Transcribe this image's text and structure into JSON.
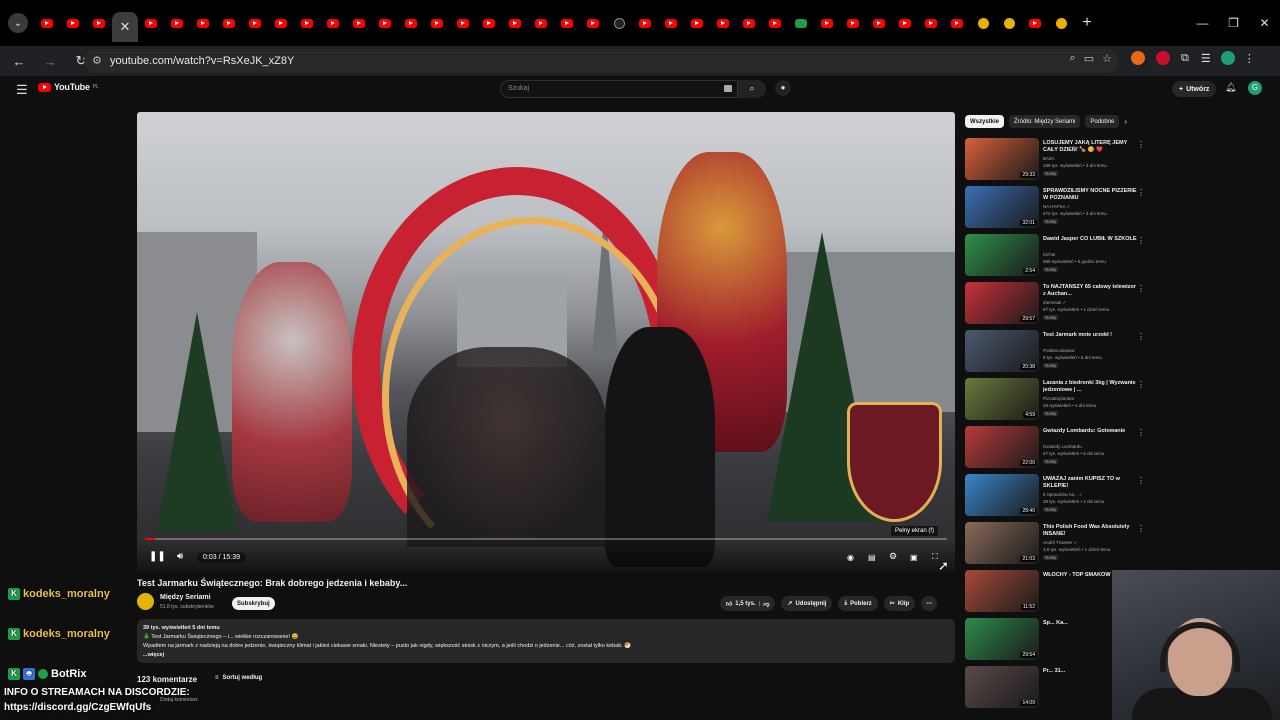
{
  "browser": {
    "url": "youtube.com/watch?v=RsXeJK_xZ8Y",
    "tab_count_before_active": 3,
    "tab_count_after_active": 39,
    "accent_youtube": "#ff0000"
  },
  "yt": {
    "logo_text": "YouTube",
    "logo_sup": "PL",
    "search_placeholder": "Szukaj",
    "create_label": "Utwórz",
    "avatar_letter": "G"
  },
  "player": {
    "time": "0:03 / 15:39",
    "progress_fraction": 0.003,
    "tooltip": "Pełny ekran (f)"
  },
  "video": {
    "title": "Test Jarmarku Świątecznego: Brak dobrego jedzenia i kebaby...",
    "channel": "Między Seriami",
    "subscribers": "51,8 tys. subskrybentów",
    "subscribe_label": "Subskrybuj",
    "likes": "1,5 tys.",
    "share_label": "Udostępnij",
    "download_label": "Pobierz",
    "clip_label": "Klip",
    "desc_meta": "39 tys. wyświetleń  5 dni temu",
    "desc_line1": "🎄 Test Jarmarku Świątecznego – i... wielkie rozczarowanie! 😅",
    "desc_line2": "Wpadłem na jarmark z nadzieją na dobre jedzenie, świąteczny klimat i jakieś ciekawe smaki. Niestety – pusto jak nigdy, większość stoisk z niczym, a jeśli chodzi o jedzenie... cóż, został tylko kebab. 🥙",
    "desc_more": "...więcej",
    "comments_count": "123 komentarze",
    "sort_label": "Sortuj według",
    "add_comment": "Dodaj komentarz"
  },
  "chips": [
    "Wszystkie",
    "Źródło: Między Seriami",
    "Podobne"
  ],
  "recommendations": [
    {
      "title": "LOSUJEMY JAKĄ LITERĘ JEMY CAŁY DZIEŃ! 🍗 😋 ❤️",
      "channel": "BAZA",
      "views": "188 tys. wyświetleń • 3 dni temu",
      "badge": "Nowy",
      "dur": "29:33",
      "thumb": "#d9603a"
    },
    {
      "title": "SPRAWDZILIŚMY NOCNE PIZZERIE W POZNANIU",
      "channel": "NA HAPSA ✓",
      "views": "572 tys. wyświetleń • 3 dni temu",
      "badge": "Nowy",
      "dur": "32:01",
      "thumb": "#3b6fb6"
    },
    {
      "title": "Dawid Jasper CO LUBIŁ W SZKOLE",
      "channel": "Kicha!",
      "views": "699 wyświetleń • 5 godzin temu",
      "badge": "Nowy",
      "dur": "2:54",
      "thumb": "#2f8f4a"
    },
    {
      "title": "To NAJTAŃSZY 65 calowy telewizor z Auchan...",
      "channel": "Ziemniak ✓",
      "views": "87 tys. wyświetleń • 1 dzień temu",
      "badge": "Nowy",
      "dur": "29:57",
      "thumb": "#c8323a"
    },
    {
      "title": "Test Jarmark mnie urzekł !",
      "channel": "PodamuJasiowi",
      "views": "9 tys. wyświetleń • 5 dni temu",
      "badge": "Nowy",
      "dur": "20:38",
      "thumb": "#4a5a70"
    },
    {
      "title": "Lazania z biedronki 3kg | Wyzwanie jedzeniowe | ...",
      "channel": "PizzaExplorator",
      "views": "26 wyświetleń • 4 dni temu",
      "badge": "Nowy",
      "dur": "4:59",
      "thumb": "#6a7a3a"
    },
    {
      "title": "Gwiazdy Lombardu: Gotowanie",
      "channel": "Gwiazdy Lombardu",
      "views": "57 tys. wyświetleń • 6 dni temu",
      "badge": "Nowy",
      "dur": "22:00",
      "thumb": "#b83a3a"
    },
    {
      "title": "UWAŻAJ zanim KUPISZ TO w SKLEPIE!",
      "channel": "5 Sposobów na... ✓",
      "views": "38 tys. wyświetleń • 2 dni temu",
      "badge": "Nowy",
      "dur": "28:40",
      "thumb": "#3a86c8"
    },
    {
      "title": "This Polish Food Was Absolutely INSANE!",
      "channel": "André Traveler ✓",
      "views": "3,9 tys. wyświetleń • 1 dzień temu",
      "badge": "Nowy",
      "dur": "21:03",
      "thumb": "#8a6a5a"
    },
    {
      "title": "WŁOCHY - TOP SMAKÓW CO JA...",
      "channel": "",
      "views": "",
      "badge": "",
      "dur": "11:52",
      "thumb": "#a84a3a"
    },
    {
      "title": "Sp... Ka...",
      "channel": "",
      "views": "",
      "badge": "",
      "dur": "29:54",
      "thumb": "#2f8a4a"
    },
    {
      "title": "Pr... 31...",
      "channel": "",
      "views": "",
      "badge": "",
      "dur": "14:09",
      "thumb": "#5a4a4a"
    }
  ],
  "overlay": {
    "chat1": "kodeks_moralny",
    "chat2": "kodeks_moralny",
    "bot": "BotRix",
    "info_line1": "INFO O STREAMACH NA DISCORDZIE:",
    "info_line2": "https://discord.gg/CzgEWfqUfs"
  }
}
